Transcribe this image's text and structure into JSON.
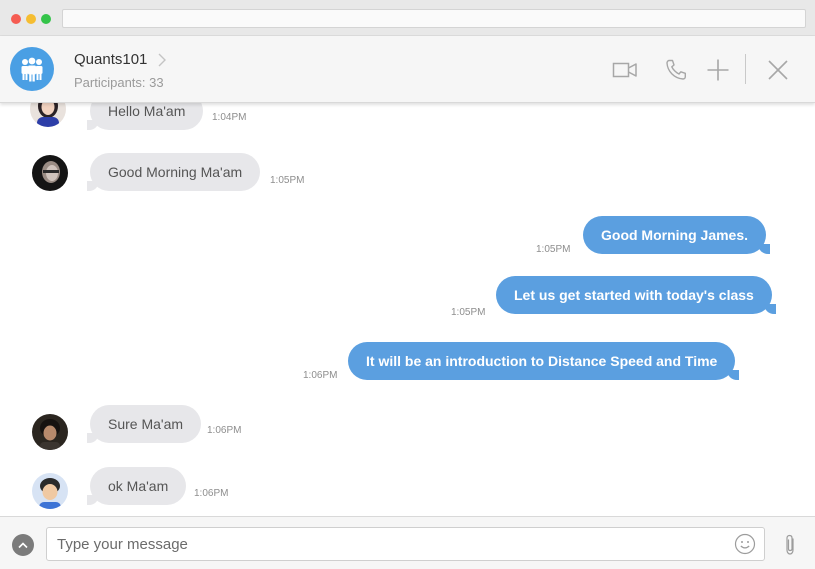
{
  "header": {
    "group_name": "Quants101",
    "participants": "Participants: 33",
    "icons": [
      "group-icon",
      "chevron-right-icon",
      "video-camera-icon",
      "phone-icon",
      "plus-icon",
      "close-icon"
    ]
  },
  "colors": {
    "accent": "#4a9fe4",
    "outgoing_bubble": "#5b9fe0",
    "incoming_bubble": "#e7e7ea"
  },
  "messages": [
    {
      "direction": "in",
      "text": "Hello Ma'am",
      "time": "1:04PM"
    },
    {
      "direction": "in",
      "text": "Good Morning Ma'am",
      "time": "1:05PM"
    },
    {
      "direction": "out",
      "text": "Good Morning James.",
      "time": "1:05PM"
    },
    {
      "direction": "out",
      "text": "Let us get started with today's class",
      "time": "1:05PM"
    },
    {
      "direction": "out",
      "text": "It will be an introduction to Distance Speed and Time",
      "time": "1:06PM"
    },
    {
      "direction": "in",
      "text": "Sure Ma'am",
      "time": "1:06PM"
    },
    {
      "direction": "in",
      "text": "ok Ma'am",
      "time": "1:06PM"
    }
  ],
  "composer": {
    "placeholder": "Type your message",
    "value": "",
    "icons": [
      "chevron-up-icon",
      "emoji-icon",
      "paperclip-icon"
    ]
  }
}
